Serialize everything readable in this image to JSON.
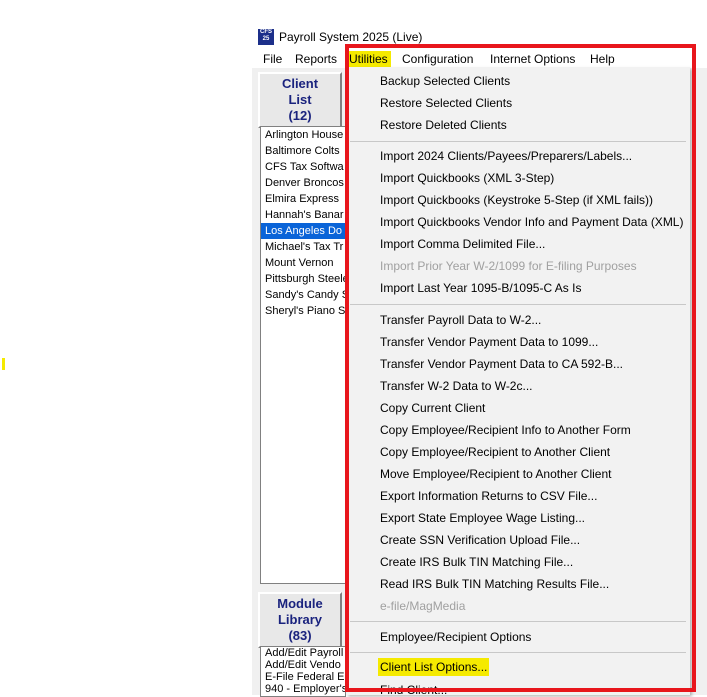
{
  "app": {
    "title": "Payroll System 2025 (Live)",
    "icon_top": "CFS",
    "icon_bottom": "25"
  },
  "menubar": [
    {
      "label": "File"
    },
    {
      "label": "Reports"
    },
    {
      "label": "Utilities"
    },
    {
      "label": "Configuration"
    },
    {
      "label": "Internet Options"
    },
    {
      "label": "Help"
    }
  ],
  "client_panel": {
    "line1": "Client",
    "line2": "List",
    "count": "(12)",
    "clients": [
      "Arlington House",
      "Baltimore Colts",
      "CFS Tax Softwa",
      "Denver Broncos",
      "Elmira Express",
      "Hannah's Banar",
      "Los Angeles Do",
      "Michael's Tax Tr",
      "Mount Vernon",
      "Pittsburgh Steele",
      "Sandy's Candy S",
      "Sheryl's Piano S"
    ],
    "selected_index": 6
  },
  "module_panel": {
    "line1": "Module",
    "line2": "Library",
    "count": "(83)",
    "modules": [
      "Add/Edit Payroll",
      "Add/Edit Vendo",
      "E-File Federal Er",
      "940 - Employer's"
    ]
  },
  "utilities_menu": {
    "items": [
      {
        "label": "Backup Selected Clients",
        "disabled": false
      },
      {
        "label": "Restore Selected Clients",
        "disabled": false
      },
      {
        "label": "Restore Deleted Clients",
        "disabled": false
      },
      {
        "label": "Import 2024 Clients/Payees/Preparers/Labels...",
        "disabled": false
      },
      {
        "label": "Import Quickbooks (XML 3-Step)",
        "disabled": false
      },
      {
        "label": "Import Quickbooks (Keystroke 5-Step (if XML fails))",
        "disabled": false
      },
      {
        "label": "Import Quickbooks Vendor Info and Payment Data (XML)",
        "disabled": false
      },
      {
        "label": "Import Comma Delimited File...",
        "disabled": false
      },
      {
        "label": "Import Prior Year W-2/1099 for E-filing Purposes",
        "disabled": true
      },
      {
        "label": "Import Last Year 1095-B/1095-C As Is",
        "disabled": false
      },
      {
        "label": "Transfer Payroll Data to W-2...",
        "disabled": false
      },
      {
        "label": "Transfer Vendor Payment Data to 1099...",
        "disabled": false
      },
      {
        "label": "Transfer Vendor Payment Data to CA 592-B...",
        "disabled": false
      },
      {
        "label": "Transfer W-2 Data to W-2c...",
        "disabled": false
      },
      {
        "label": "Copy Current Client",
        "disabled": false
      },
      {
        "label": "Copy Employee/Recipient Info to Another Form",
        "disabled": false
      },
      {
        "label": "Copy Employee/Recipient to Another Client",
        "disabled": false
      },
      {
        "label": "Move Employee/Recipient to Another Client",
        "disabled": false
      },
      {
        "label": "Export Information Returns to CSV File...",
        "disabled": false
      },
      {
        "label": "Export State Employee Wage Listing...",
        "disabled": false
      },
      {
        "label": "Create SSN Verification Upload File...",
        "disabled": false
      },
      {
        "label": "Create IRS Bulk TIN Matching File...",
        "disabled": false
      },
      {
        "label": "Read IRS Bulk TIN Matching Results File...",
        "disabled": false
      },
      {
        "label": "e-file/MagMedia",
        "disabled": true
      },
      {
        "label": "Employee/Recipient Options",
        "disabled": false
      },
      {
        "label": "Client List Options...",
        "disabled": false
      },
      {
        "label": "Find Client...",
        "disabled": false
      }
    ]
  },
  "colors": {
    "highlight": "#f5ea00",
    "annotation_frame": "#e8161c",
    "selection": "#0a64d8",
    "panel_button_text": "#1a237e"
  }
}
